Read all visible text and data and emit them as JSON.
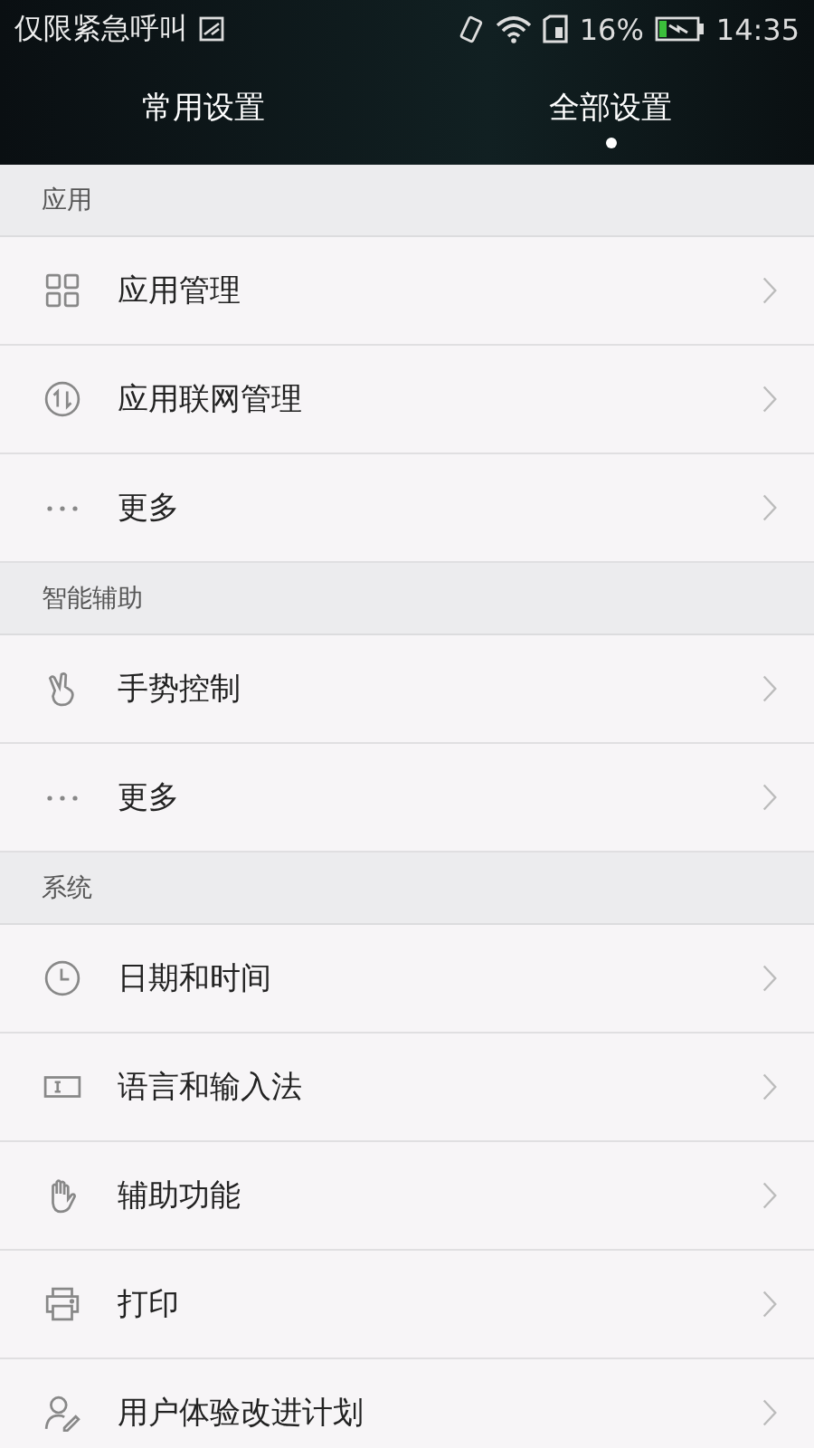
{
  "status_bar": {
    "carrier": "仅限紧急呼叫",
    "battery": "16%",
    "time": "14:35"
  },
  "tabs": [
    {
      "label": "常用设置",
      "selected": false
    },
    {
      "label": "全部设置",
      "selected": true
    }
  ],
  "sections": [
    {
      "title": "应用",
      "items": [
        {
          "kind": "grid",
          "label": "应用管理"
        },
        {
          "kind": "network",
          "label": "应用联网管理"
        },
        {
          "kind": "more",
          "label": "更多"
        }
      ]
    },
    {
      "title": "智能辅助",
      "items": [
        {
          "kind": "gesture",
          "label": "手势控制"
        },
        {
          "kind": "more",
          "label": "更多"
        }
      ]
    },
    {
      "title": "系统",
      "items": [
        {
          "kind": "clock",
          "label": "日期和时间"
        },
        {
          "kind": "keyboard",
          "label": "语言和输入法"
        },
        {
          "kind": "hand",
          "label": "辅助功能"
        },
        {
          "kind": "printer",
          "label": "打印"
        },
        {
          "kind": "user",
          "label": "用户体验改进计划"
        }
      ]
    }
  ]
}
